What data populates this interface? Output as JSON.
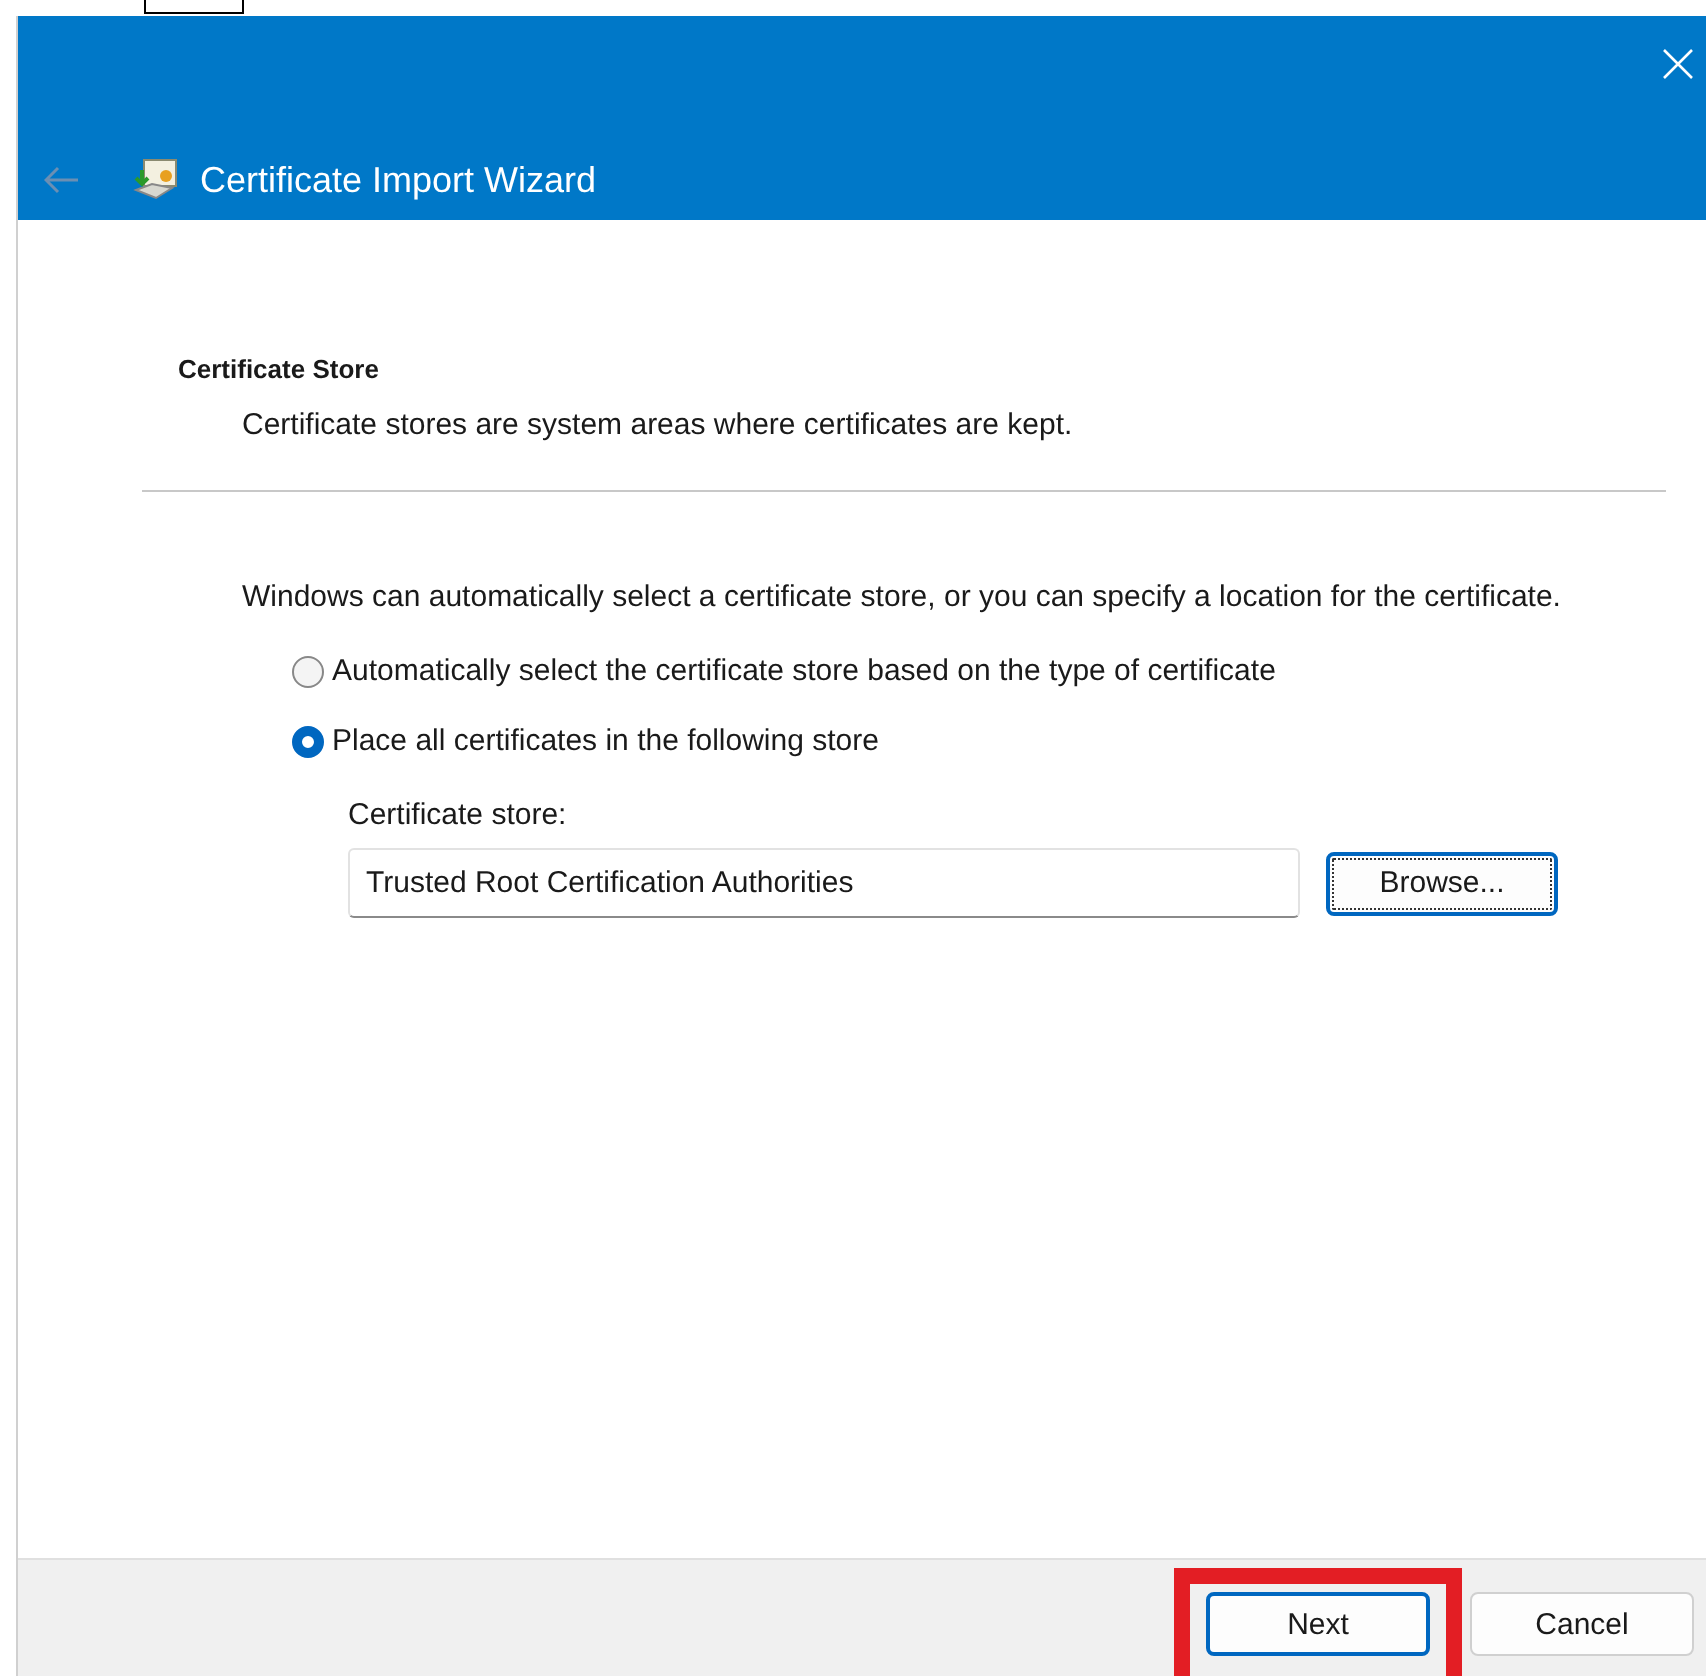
{
  "window": {
    "title": "Certificate Import Wizard"
  },
  "page": {
    "heading": "Certificate Store",
    "subheading": "Certificate stores are system areas where certificates are kept."
  },
  "description": "Windows can automatically select a certificate store, or you can specify a location for the certificate.",
  "options": [
    {
      "label": "Automatically select the certificate store based on the type of certificate",
      "selected": false
    },
    {
      "label": "Place all certificates in the following store",
      "selected": true
    }
  ],
  "store": {
    "label": "Certificate store:",
    "value": "Trusted Root Certification Authorities",
    "button": "Browse..."
  },
  "buttons": [
    {
      "label": "Next",
      "default": true,
      "highlighted": true
    },
    {
      "label": "Cancel",
      "default": false,
      "highlighted": false
    }
  ]
}
